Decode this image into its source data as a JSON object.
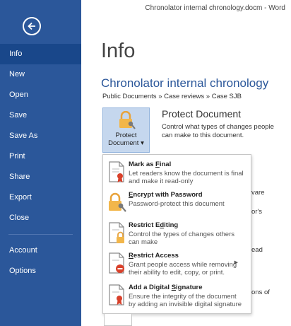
{
  "window": {
    "title": "Chronolator internal chronology.docm - Word"
  },
  "nav": {
    "items": [
      {
        "label": "Info",
        "active": true
      },
      {
        "label": "New"
      },
      {
        "label": "Open"
      },
      {
        "label": "Save"
      },
      {
        "label": "Save As"
      },
      {
        "label": "Print"
      },
      {
        "label": "Share"
      },
      {
        "label": "Export"
      },
      {
        "label": "Close"
      },
      {
        "label": "Account"
      },
      {
        "label": "Options"
      }
    ]
  },
  "main": {
    "page_title": "Info",
    "doc_title": "Chronolator internal chronology",
    "breadcrumb": "Public Documents » Case reviews » Case SJB",
    "protect": {
      "button_line1": "Protect",
      "button_line2": "Document ▾",
      "heading": "Protect Document",
      "description": "Control what types of changes people can make to this document."
    },
    "background_fragments": [
      "vare",
      "or's",
      "ead",
      "ons of"
    ]
  },
  "menu": {
    "items": [
      {
        "title_prefix": "Mark as ",
        "title_access": "F",
        "title_suffix": "inal",
        "desc": "Let readers know the document is final and make it read-only",
        "icon": "mark-final-icon"
      },
      {
        "title_prefix": "",
        "title_access": "E",
        "title_suffix": "ncrypt with Password",
        "desc": "Password-protect this document",
        "icon": "lock-key-icon"
      },
      {
        "title_prefix": "Restrict E",
        "title_access": "d",
        "title_suffix": "iting",
        "desc": "Control the types of changes others can make",
        "icon": "restrict-editing-icon"
      },
      {
        "title_prefix": "",
        "title_access": "R",
        "title_suffix": "estrict Access",
        "desc": "Grant people access while removing their ability to edit, copy, or print.",
        "icon": "restrict-access-icon",
        "has_submenu": true
      },
      {
        "title_prefix": "Add a Digital ",
        "title_access": "S",
        "title_suffix": "ignature",
        "desc": "Ensure the integrity of the document by adding an invisible digital signature",
        "icon": "digital-signature-icon"
      }
    ]
  },
  "colors": {
    "accent": "#2b579a",
    "nav_active": "#19478a",
    "button_highlight": "#c5d7ee"
  }
}
